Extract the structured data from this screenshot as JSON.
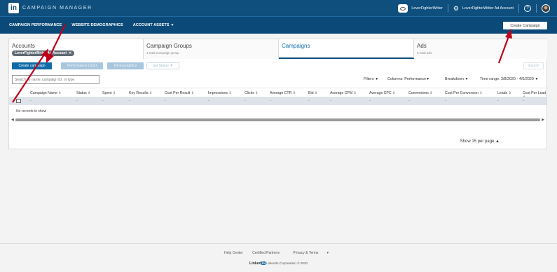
{
  "app": {
    "logo_text": "in",
    "title": "CAMPAIGN MANAGER"
  },
  "topbar": {
    "account_name": "LoverFighterWriter",
    "ad_account": "LoverFighterWriter Ad Account",
    "help_label": "?"
  },
  "nav": {
    "items": [
      "CAMPAIGN PERFORMANCE",
      "WEBSITE DEMOGRAPHICS",
      "ACCOUNT ASSETS"
    ],
    "create_campaign": "Create Campaign"
  },
  "tabs": [
    {
      "title": "Accounts",
      "chip": "LoverFighterWriter Ad Account"
    },
    {
      "title": "Campaign Groups",
      "sub": "1 total campaign group"
    },
    {
      "title": "Campaigns",
      "sub": ""
    },
    {
      "title": "Ads",
      "sub": "0 total ads"
    }
  ],
  "toolbar": {
    "create": "Create campaign",
    "performance_chart": "Performance Chart",
    "demographics": "Demographics",
    "set_status": "Set Status",
    "export": "Export"
  },
  "filters": {
    "search_placeholder": "Search by name, campaign ID, or type",
    "filters_label": "Filters",
    "columns_label": "Columns:",
    "columns_value": "Performance",
    "breakdown_label": "Breakdown",
    "time_range": "Time range: 3/8/2020 - 4/6/2020"
  },
  "table": {
    "columns": [
      "Campaign Name",
      "Status",
      "Spent",
      "Key Results",
      "Cost Per Result",
      "Impressions",
      "Clicks",
      "Average CTR",
      "Bid",
      "Average CPM",
      "Average CPC",
      "Conversions",
      "Cost Per Conversion",
      "Leads",
      "Cost Per Lead"
    ],
    "filler": "-",
    "empty_message": "No records to show"
  },
  "pager": {
    "label": "Show 15 per page"
  },
  "footer": {
    "links": [
      "Help Center",
      "Certified Partners",
      "Privacy & Terms"
    ],
    "brand": "Linked",
    "brand_in": "in",
    "copyright": "LinkedIn Corporation © 2020"
  },
  "colors": {
    "brand": "#0e4f7e",
    "accent": "#0e6ba8",
    "annotation": "#c0001a"
  }
}
